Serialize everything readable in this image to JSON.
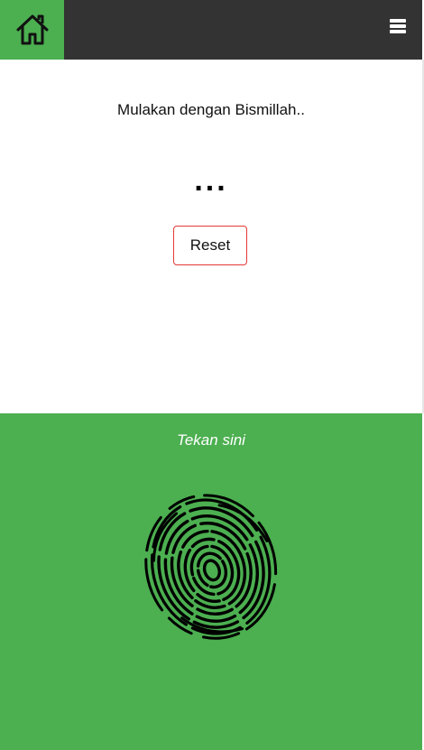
{
  "header": {
    "home_icon": "home-icon",
    "menu_icon": "hamburger-menu-icon",
    "colors": {
      "bar": "#333333",
      "home_bg": "#4caf50"
    }
  },
  "counter": {
    "prompt": "Mulakan dengan Bismillah..",
    "count": "...",
    "reset_label": "Reset",
    "colors": {
      "reset_border": "#e53935"
    }
  },
  "tap": {
    "label": "Tekan sini",
    "icon": "fingerprint-icon",
    "colors": {
      "background": "#4caf50"
    }
  }
}
